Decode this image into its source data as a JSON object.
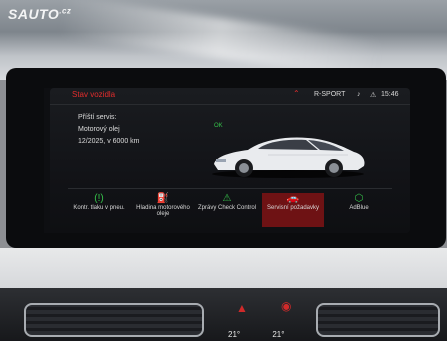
{
  "watermark": {
    "text": "SAUTO",
    "suffix": ".cz"
  },
  "header": {
    "title": "Stav vozidla",
    "mode": "R-SPORT",
    "time": "15:46"
  },
  "service": {
    "label": "Příští servis:",
    "item": "Motorový olej",
    "due": "12/2025, v 6000 km"
  },
  "status": {
    "ok_label": "OK"
  },
  "tiles": [
    {
      "label": "Kontr. tlaku v pneu.",
      "icon": "tire-pressure-icon"
    },
    {
      "label": "Hladina motorového oleje",
      "icon": "oil-can-icon"
    },
    {
      "label": "Zprávy Check Control",
      "icon": "warning-triangle-icon"
    },
    {
      "label": "Servisní požadavky",
      "icon": "car-service-icon"
    },
    {
      "label": "AdBlue",
      "icon": "adblue-icon"
    }
  ],
  "climate": {
    "left_temp": "21°",
    "right_temp": "21°"
  },
  "colors": {
    "accent": "#e22c2c",
    "ok": "#35c24a",
    "selected_tile": "#6e1214"
  }
}
